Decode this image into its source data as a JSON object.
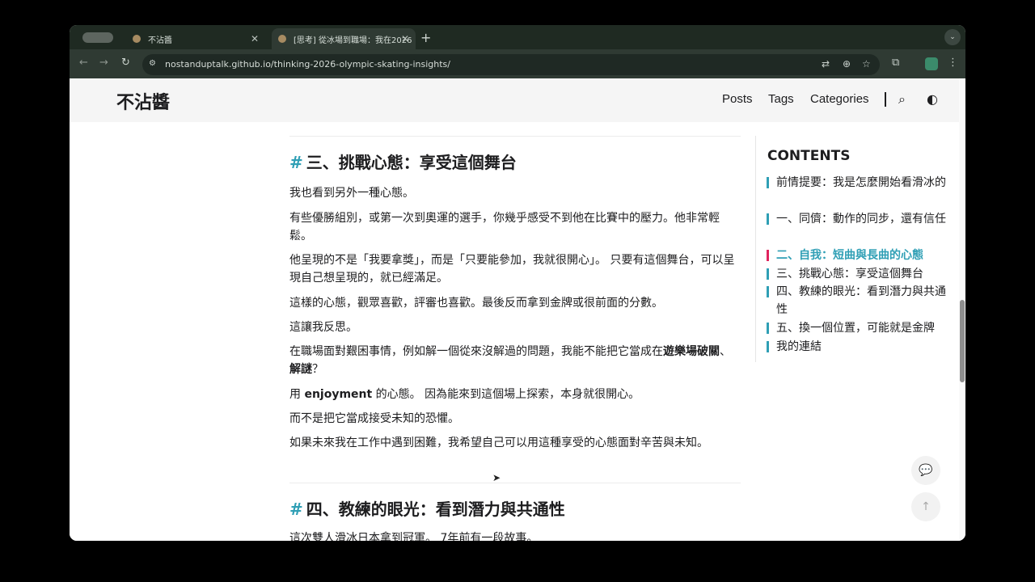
{
  "browser": {
    "tabs": [
      {
        "title": "不沾醬"
      },
      {
        "title": "[思考] 從冰場到職場：我在2026"
      }
    ],
    "new_tab": "+",
    "url": "nostanduptalk.github.io/thinking-2026-olympic-skating-insights/"
  },
  "site": {
    "logo": "不沾醬",
    "nav": [
      "Posts",
      "Tags",
      "Categories"
    ]
  },
  "article": {
    "top_partial": "· · ·",
    "section3": {
      "hash": "#",
      "title": "三、挑戰心態：享受這個舞台",
      "p1": "我也看到另外一種心態。",
      "p2": "有些優勝組別，或第一次到奧運的選手，你幾乎感受不到他在比賽中的壓力。他非常輕鬆。",
      "p3": "他呈現的不是「我要拿獎」，而是「只要能參加，我就很開心」。 只要有這個舞台，可以呈現自己想呈現的，就已經滿足。",
      "p4": "這樣的心態，觀眾喜歡，評審也喜歡。最後反而拿到金牌或很前面的分數。",
      "p5": "這讓我反思。",
      "p6_a": "在職場面對艱困事情，例如解一個從來沒解過的問題，我能不能把它當成在",
      "p6_b": "遊樂場破關",
      "p6_c": "、",
      "p6_d": "解謎",
      "p6_e": "？",
      "p7_a": "用 ",
      "p7_b": "enjoyment",
      "p7_c": " 的心態。 因為能來到這個場上探索，本身就很開心。",
      "p8": "而不是把它當成接受未知的恐懼。",
      "p9": "如果未來我在工作中遇到困難，我希望自己可以用這種享受的心態面對辛苦與未知。"
    },
    "section4": {
      "hash": "#",
      "title": "四、教練的眼光：看到潛力與共通性",
      "p1": "這次雙人滑冰日本拿到冠軍。 7年前有一段故事。"
    }
  },
  "toc": {
    "title": "CONTENTS",
    "items": [
      {
        "label": "前情提要：我是怎麼開始看滑冰的",
        "active": false
      },
      {
        "label": "一、同儕：動作的同步，還有信任",
        "active": false
      },
      {
        "label": "二、自我：短曲與長曲的心態",
        "active": true
      },
      {
        "label": "三、挑戰心態：享受這個舞台",
        "active": false
      },
      {
        "label": "四、教練的眼光：看到潛力與共通性",
        "active": false
      },
      {
        "label": "五、換一個位置，可能就是金牌",
        "active": false
      },
      {
        "label": "我的連結",
        "active": false
      }
    ]
  },
  "icons": {
    "comment": "comment-icon",
    "scroll_top": "arrow-up-icon",
    "search": "search-icon",
    "theme": "theme-toggle-icon"
  },
  "colors": {
    "accent": "#2f9fb5",
    "active_marker": "#e0245e"
  }
}
